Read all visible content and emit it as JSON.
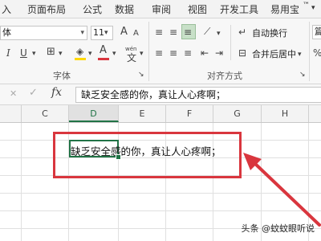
{
  "ribbon_tabs": [
    "入",
    "页面布局",
    "公式",
    "数据",
    "审阅",
    "视图",
    "开发工具",
    "易用宝"
  ],
  "ribbon_extra": {
    "overflow_mark": "™",
    "dropdown_icon": "chevron-down-icon"
  },
  "font_group": {
    "font_name": "体",
    "font_size": "11",
    "grow_label": "A",
    "shrink_label": "A",
    "italic_label": "I",
    "underline_label": "U",
    "font_color_label": "A",
    "pinyin_label": "wén",
    "label": "字体"
  },
  "alignment_group": {
    "wrap_text": "自动换行",
    "merge_center": "合并后居中",
    "label": "对齐方式"
  },
  "number_group": {
    "format_partial": "篇"
  },
  "formula_bar": {
    "cancel_icon": "✕",
    "confirm_icon": "✓",
    "fx_label": "fx",
    "content": "缺乏安全感的你，真让人心疼啊；"
  },
  "columns": [
    "C",
    "D",
    "E",
    "F",
    "G",
    "H"
  ],
  "selected_column": "D",
  "cell": {
    "text": "缺乏安全感的你，真让人心疼啊；"
  },
  "annotation": {
    "color": "#d9363e"
  },
  "accent_color": "#217346",
  "watermark": "头条 @蚊蚊眼听说"
}
